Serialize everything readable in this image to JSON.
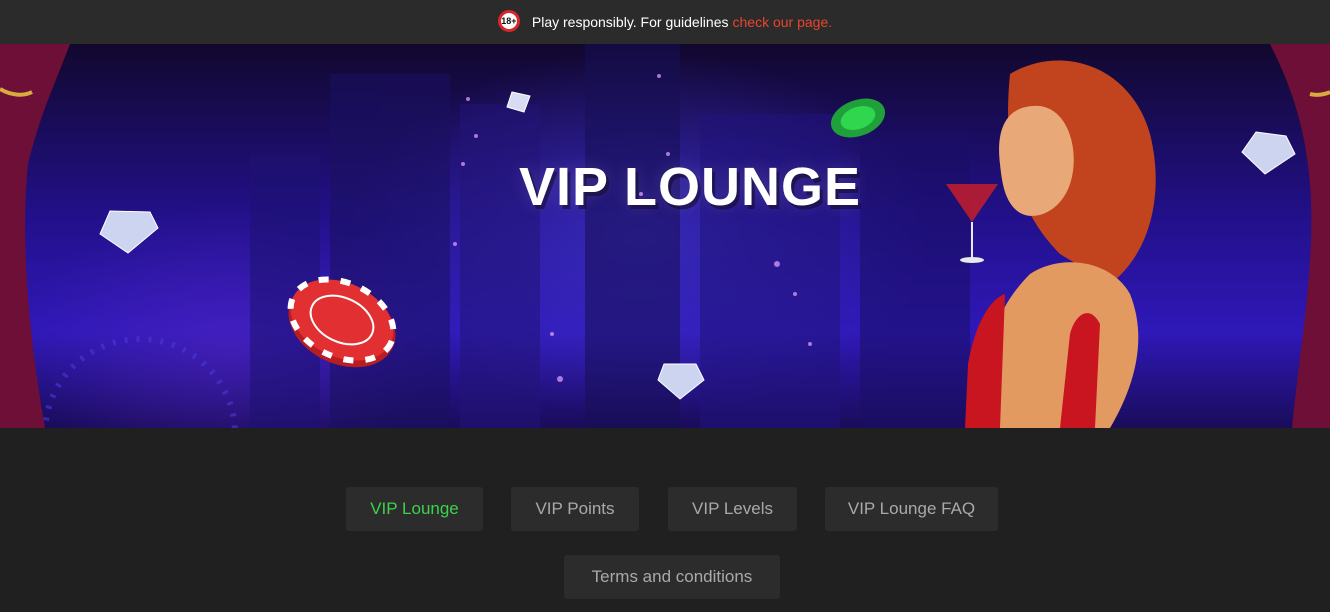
{
  "notice": {
    "badge": "18+",
    "text": "Play responsibly. For guidelines",
    "link": "check our page."
  },
  "hero": {
    "title": "VIP LOUNGE"
  },
  "tabs": [
    {
      "label": "VIP Lounge",
      "active": true
    },
    {
      "label": "VIP Points",
      "active": false
    },
    {
      "label": "VIP Levels",
      "active": false
    },
    {
      "label": "VIP Lounge FAQ",
      "active": false
    },
    {
      "label": "Terms and conditions",
      "active": false
    }
  ],
  "colors": {
    "page_bg": "#202020",
    "topbar_bg": "#2b2b2b",
    "link": "#e8452f",
    "active_tab": "#3cd34a",
    "tab_text": "#a9a9a9",
    "tab_bg": "#2c2c2c"
  }
}
